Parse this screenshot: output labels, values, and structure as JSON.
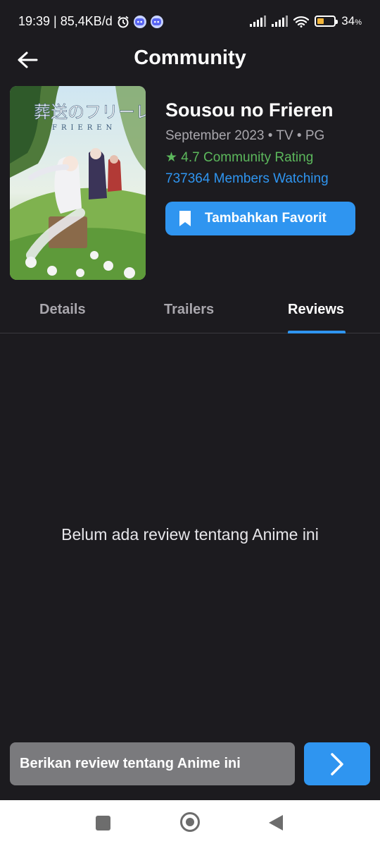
{
  "status_bar": {
    "time_net": "19:39 | 85,4KB/d",
    "battery": "34",
    "battery_unit": "%",
    "icons": [
      "alarm-icon",
      "discord-icon",
      "discord-icon",
      "signal-icon",
      "signal-icon",
      "wifi-icon",
      "battery-icon"
    ]
  },
  "header": {
    "title": "Community",
    "back_icon": "arrow-left-icon"
  },
  "anime": {
    "title": "Sousou no Frieren",
    "meta": "September 2023 • TV • PG",
    "rating": "★ 4.7 Community Rating",
    "members": "737364 Members Watching",
    "favorite_label": "Tambahkan Favorit",
    "poster_text": "葬送のフリーレン",
    "poster_subtext": "FRIEREN"
  },
  "tabs": [
    {
      "label": "Details",
      "active": false
    },
    {
      "label": "Trailers",
      "active": false
    },
    {
      "label": "Reviews",
      "active": true
    }
  ],
  "reviews": {
    "empty_message": "Belum ada review tentang Anime ini",
    "input_placeholder": "Berikan review tentang Anime ini",
    "send_icon": "chevron-right-icon"
  },
  "colors": {
    "accent": "#2f95f0",
    "rating": "#5cb85c",
    "background": "#1c1b1f"
  }
}
